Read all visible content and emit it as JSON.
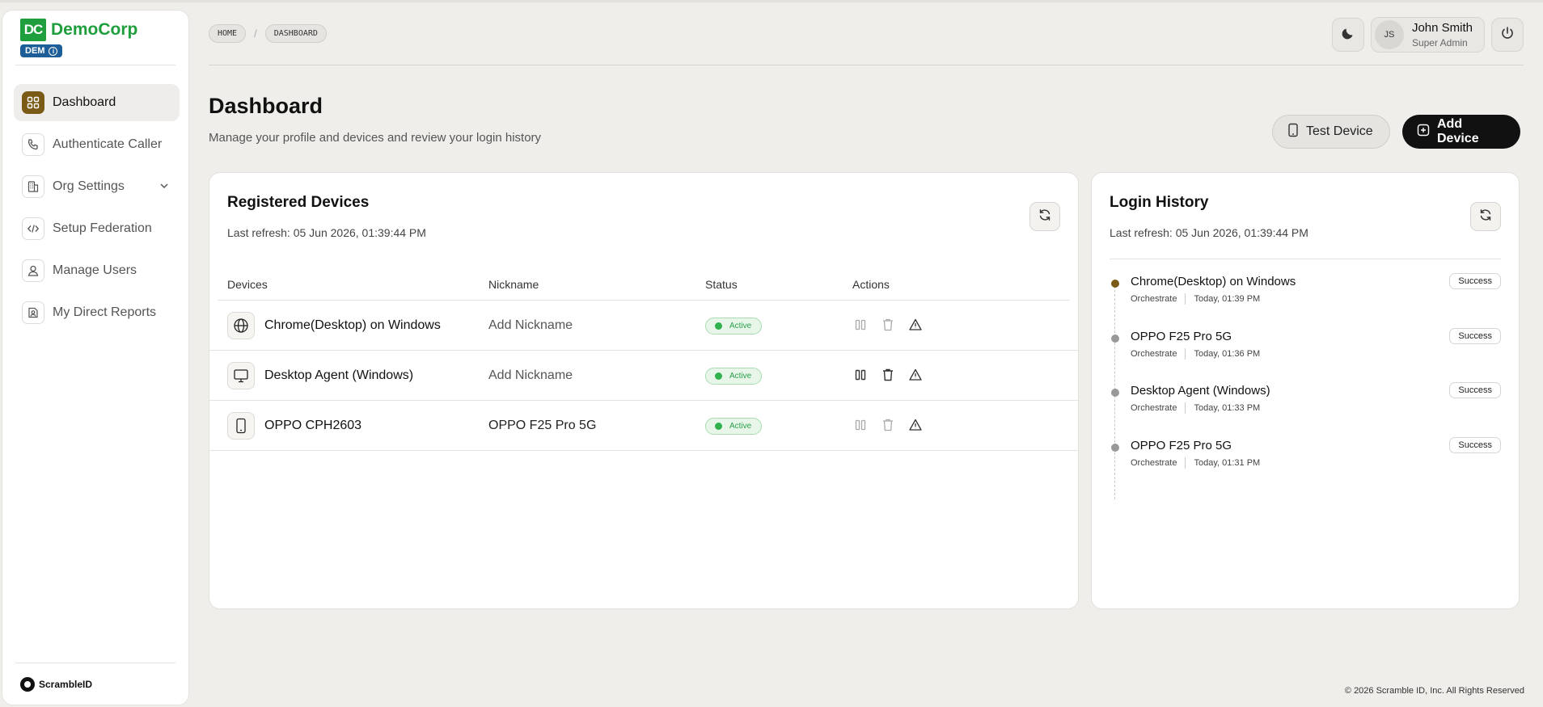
{
  "brand": {
    "logo": "DC",
    "name": "DemoCorp",
    "tag": "DEM"
  },
  "sidebar": {
    "items": [
      {
        "label": "Dashboard",
        "icon": "grid-icon",
        "active": true
      },
      {
        "label": "Authenticate Caller",
        "icon": "phone-icon"
      },
      {
        "label": "Org Settings",
        "icon": "building-icon",
        "expandable": true
      },
      {
        "label": "Setup Federation",
        "icon": "code-icon"
      },
      {
        "label": "Manage Users",
        "icon": "user-icon"
      },
      {
        "label": "My Direct Reports",
        "icon": "reports-icon"
      }
    ],
    "footer": "ScrambleID"
  },
  "breadcrumb": [
    "HOME",
    "/",
    "DASHBOARD"
  ],
  "user": {
    "initials": "JS",
    "name": "John Smith",
    "role": "Super Admin"
  },
  "page": {
    "title": "Dashboard",
    "subtitle": "Manage your profile and devices and review your login history",
    "test_device": "Test Device",
    "add_device": "Add Device"
  },
  "devices": {
    "title": "Registered Devices",
    "last_refresh": "Last refresh: 05 Jun 2026, 01:39:44 PM",
    "columns": [
      "Devices",
      "Nickname",
      "Status",
      "Actions"
    ],
    "rows": [
      {
        "name": "Chrome(Desktop) on Windows",
        "nickname": "Add Nickname",
        "status": "Active",
        "icon": "globe-icon"
      },
      {
        "name": "Desktop Agent (Windows)",
        "nickname": "Add Nickname",
        "status": "Active",
        "icon": "monitor-icon"
      },
      {
        "name": "OPPO CPH2603",
        "nickname": "OPPO F25 Pro 5G",
        "status": "Active",
        "icon": "phone-device-icon"
      }
    ]
  },
  "history": {
    "title": "Login History",
    "last_refresh": "Last refresh: 05 Jun 2026, 01:39:44 PM",
    "items": [
      {
        "device": "Chrome(Desktop) on Windows",
        "app": "Orchestrate",
        "time": "Today, 01:39 PM",
        "result": "Success"
      },
      {
        "device": "OPPO F25 Pro 5G",
        "app": "Orchestrate",
        "time": "Today, 01:36 PM",
        "result": "Success"
      },
      {
        "device": "Desktop Agent (Windows)",
        "app": "Orchestrate",
        "time": "Today, 01:33 PM",
        "result": "Success"
      },
      {
        "device": "OPPO F25 Pro 5G",
        "app": "Orchestrate",
        "time": "Today, 01:31 PM",
        "result": "Success"
      }
    ]
  },
  "copyright": "© 2026 Scramble ID, Inc. All Rights Reserved",
  "colors": {
    "brand": "#1e9e3c",
    "accent": "#7a5a16",
    "status_active": "#31b24f"
  }
}
